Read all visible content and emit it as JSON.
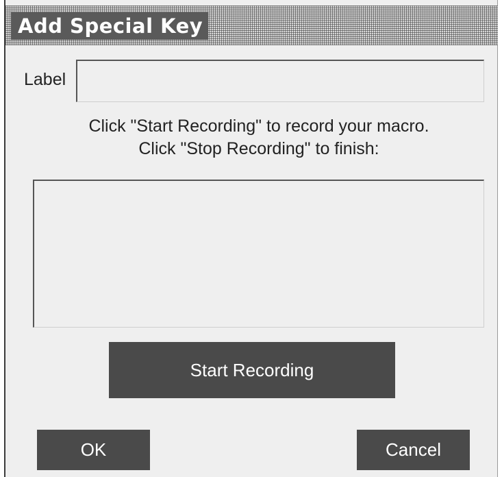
{
  "dialog": {
    "title": "Add Special Key",
    "label_caption": "Label",
    "label_value": "",
    "instructions_line1": "Click \"Start Recording\" to record your macro.",
    "instructions_line2": "Click \"Stop Recording\" to finish:",
    "macro_value": "",
    "start_recording_label": "Start Recording",
    "ok_label": "OK",
    "cancel_label": "Cancel"
  },
  "colors": {
    "dialog_background": "#efefef",
    "title_background": "#5a5a5a",
    "button_background": "#4a4a4a",
    "button_text": "#ffffff"
  }
}
